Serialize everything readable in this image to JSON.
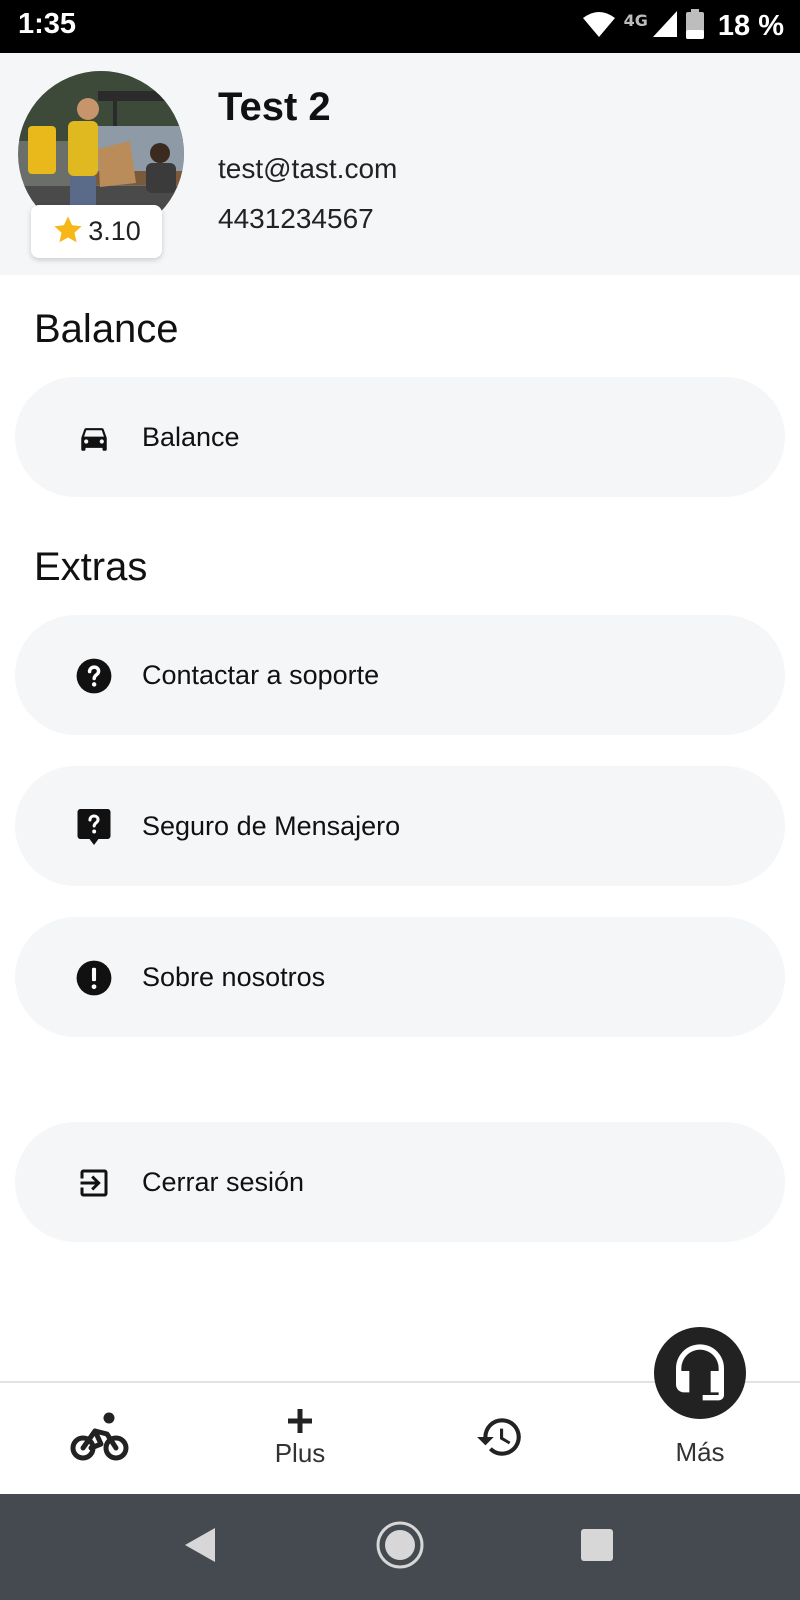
{
  "status_bar": {
    "time": "1:35",
    "network": "4G",
    "battery": "18 %"
  },
  "profile": {
    "name": "Test 2",
    "email": "test@tast.com",
    "phone": "4431234567",
    "rating": "3.10"
  },
  "sections": {
    "balance_title": "Balance",
    "extras_title": "Extras"
  },
  "menu": {
    "balance": "Balance",
    "support": "Contactar a soporte",
    "insurance": "Seguro de Mensajero",
    "about": "Sobre nosotros",
    "logout": "Cerrar sesión"
  },
  "bottom_nav": {
    "plus_label": "Plus",
    "more_label": "Más"
  },
  "colors": {
    "star": "#f7b718",
    "card_bg": "#f5f6f8",
    "fab_bg": "#222222",
    "system_nav_bg": "#444a50"
  }
}
